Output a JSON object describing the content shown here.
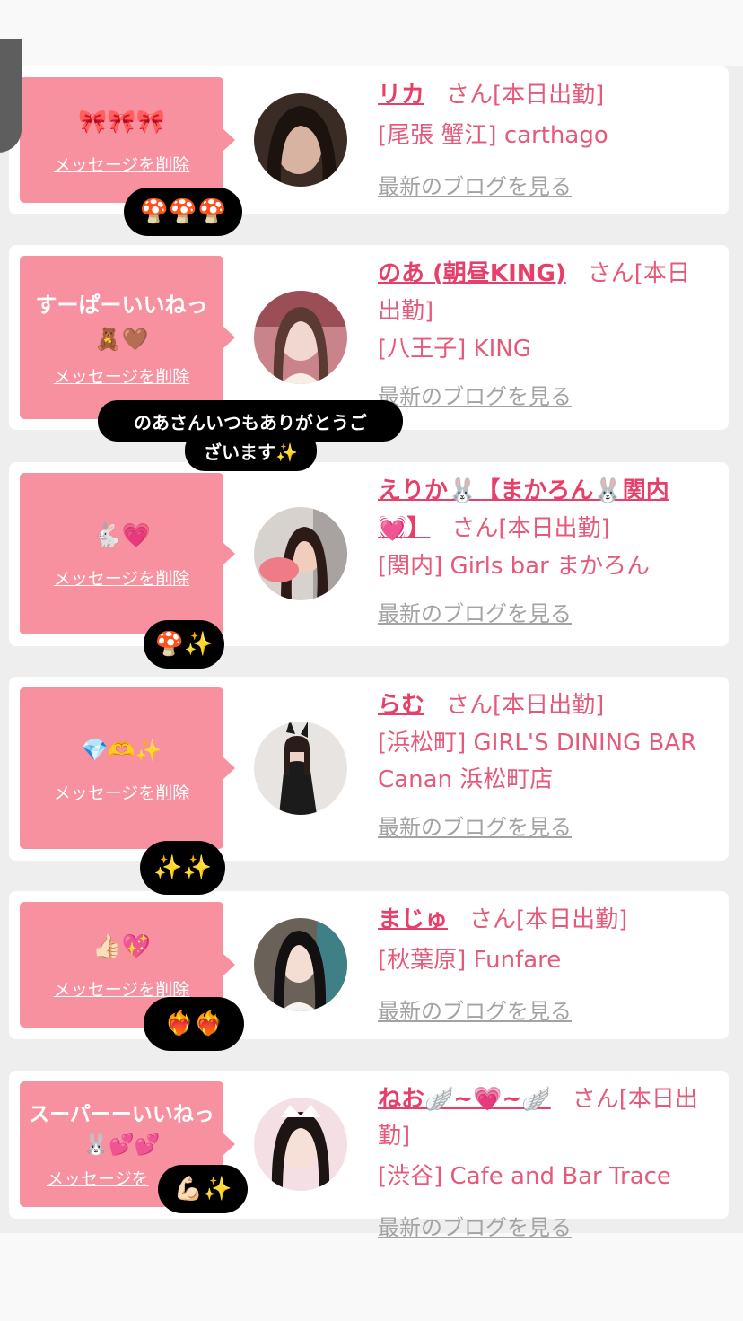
{
  "colors": {
    "accent": "#f7909f",
    "name": "#e83f6a",
    "text": "#e55a7a",
    "link_gray": "#a3a3a3",
    "pill": "#000000"
  },
  "delete_label": "メッセージを削除",
  "delete_label_partial": "メッセージを",
  "blog_label": "最新のブログを見る",
  "cards": [
    {
      "message": "🎀🎀🎀",
      "name": "リカ",
      "name_cont": "",
      "suffix": "さん[本日出勤]",
      "shop": "[尾張 蟹江] carthago",
      "shop_cont": "",
      "reaction": "🍄🍄🍄",
      "avatar_icon": "avatar-photo"
    },
    {
      "message": "すーぱーいいねっ🧸🤎",
      "name": "のあ (朝昼KING)",
      "name_cont": "出勤]",
      "suffix": "さん[本日",
      "shop": "[八王子] KING",
      "shop_cont": "",
      "reaction": "",
      "reply": [
        "のあさんいつもありがとうご",
        "ざいます✨"
      ],
      "avatar_icon": "avatar-photo"
    },
    {
      "message": "🐇💗",
      "name": "えりか🐰【まかろん🐰関内",
      "name_cont": "💓】",
      "suffix": "さん[本日出勤]",
      "shop": "[関内] Girls bar まかろん",
      "shop_cont": "",
      "reaction": "🍄✨",
      "avatar_icon": "avatar-photo"
    },
    {
      "message": "💎🫶✨",
      "name": "らむ",
      "name_cont": "",
      "suffix": "さん[本日出勤]",
      "shop": "[浜松町] GIRL'S DINING BAR",
      "shop_cont": "Canan 浜松町店",
      "reaction": "✨✨",
      "avatar_icon": "avatar-photo"
    },
    {
      "message": "👍🏻💖",
      "name": "まじゅ",
      "name_cont": "",
      "suffix": "さん[本日出勤]",
      "shop": "[秋葉原] Funfare",
      "shop_cont": "",
      "reaction": "❤️‍🔥❤️‍🔥",
      "avatar_icon": "avatar-photo"
    },
    {
      "message": "スーパーーいいねっ🐰💕💕",
      "name": "ねお🪽~💗~🪽",
      "name_cont": "",
      "suffix": "さん[本日出勤]",
      "shop": "[渋谷] Cafe and Bar Trace",
      "shop_cont": "",
      "reaction": "💪🏻✨",
      "avatar_icon": "avatar-photo"
    }
  ]
}
